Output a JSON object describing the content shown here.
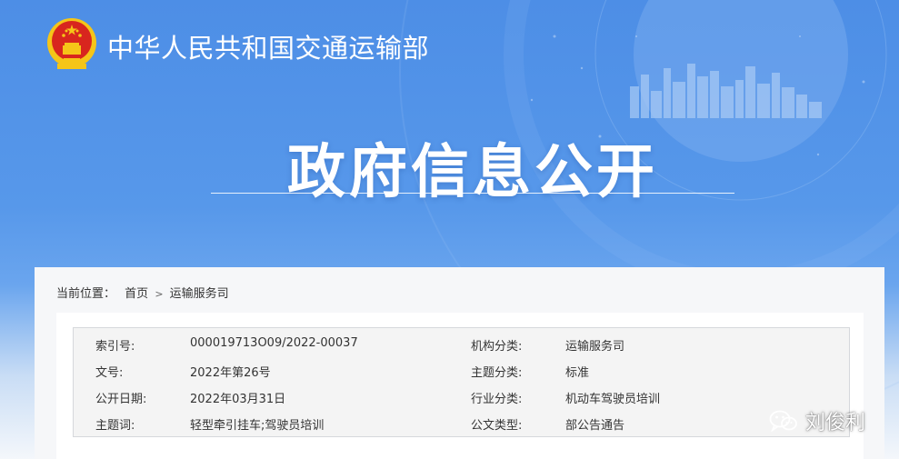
{
  "header": {
    "ministry_name": "中华人民共和国交通运输部",
    "section_title": "政府信息公开"
  },
  "breadcrumb": {
    "label": "当前位置：",
    "items": [
      "首页",
      "运输服务司"
    ],
    "separator": ">"
  },
  "metadata": {
    "rows": [
      {
        "k1": "索引号:",
        "v1": "000019713O09/2022-00037",
        "k2": "机构分类:",
        "v2": "运输服务司"
      },
      {
        "k1": "文号:",
        "v1": "2022年第26号",
        "k2": "主题分类:",
        "v2": "标准"
      },
      {
        "k1": "公开日期:",
        "v1": "2022年03月31日",
        "k2": "行业分类:",
        "v2": "机动车驾驶员培训"
      },
      {
        "k1": "主题词:",
        "v1": "轻型牵引挂车;驾驶员培训",
        "k2": "公文类型:",
        "v2": "部公告通告"
      }
    ]
  },
  "watermark": {
    "icon": "wechat-icon",
    "text": "刘俊利"
  },
  "colors": {
    "banner_top": "#4d8ee6",
    "banner_bottom": "#f4f7fb",
    "emblem_red": "#d8261e",
    "emblem_gold": "#f5c518"
  }
}
